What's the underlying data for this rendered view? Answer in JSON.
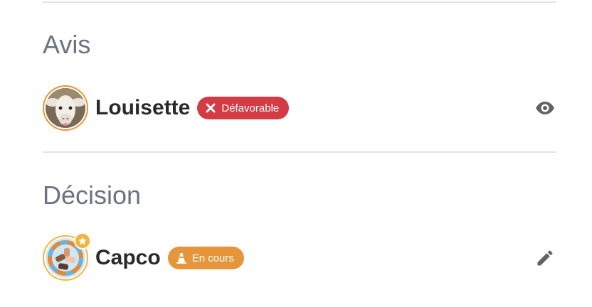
{
  "avis": {
    "title": "Avis",
    "author_name": "Louisette",
    "status_label": "Défavorable",
    "status_icon": "close-icon",
    "status_color": "#d33c45",
    "action_icon": "eye-icon"
  },
  "decision": {
    "title": "Décision",
    "author_name": "Capco",
    "status_label": "En cours",
    "status_icon": "traffic-cone-icon",
    "status_color": "#e6953a",
    "action_icon": "pencil-icon"
  },
  "colors": {
    "avatar_border": "#e6973c",
    "badge_star": "#f0b53e",
    "section_title": "#6b7280",
    "icon_gray": "#5f6368"
  }
}
